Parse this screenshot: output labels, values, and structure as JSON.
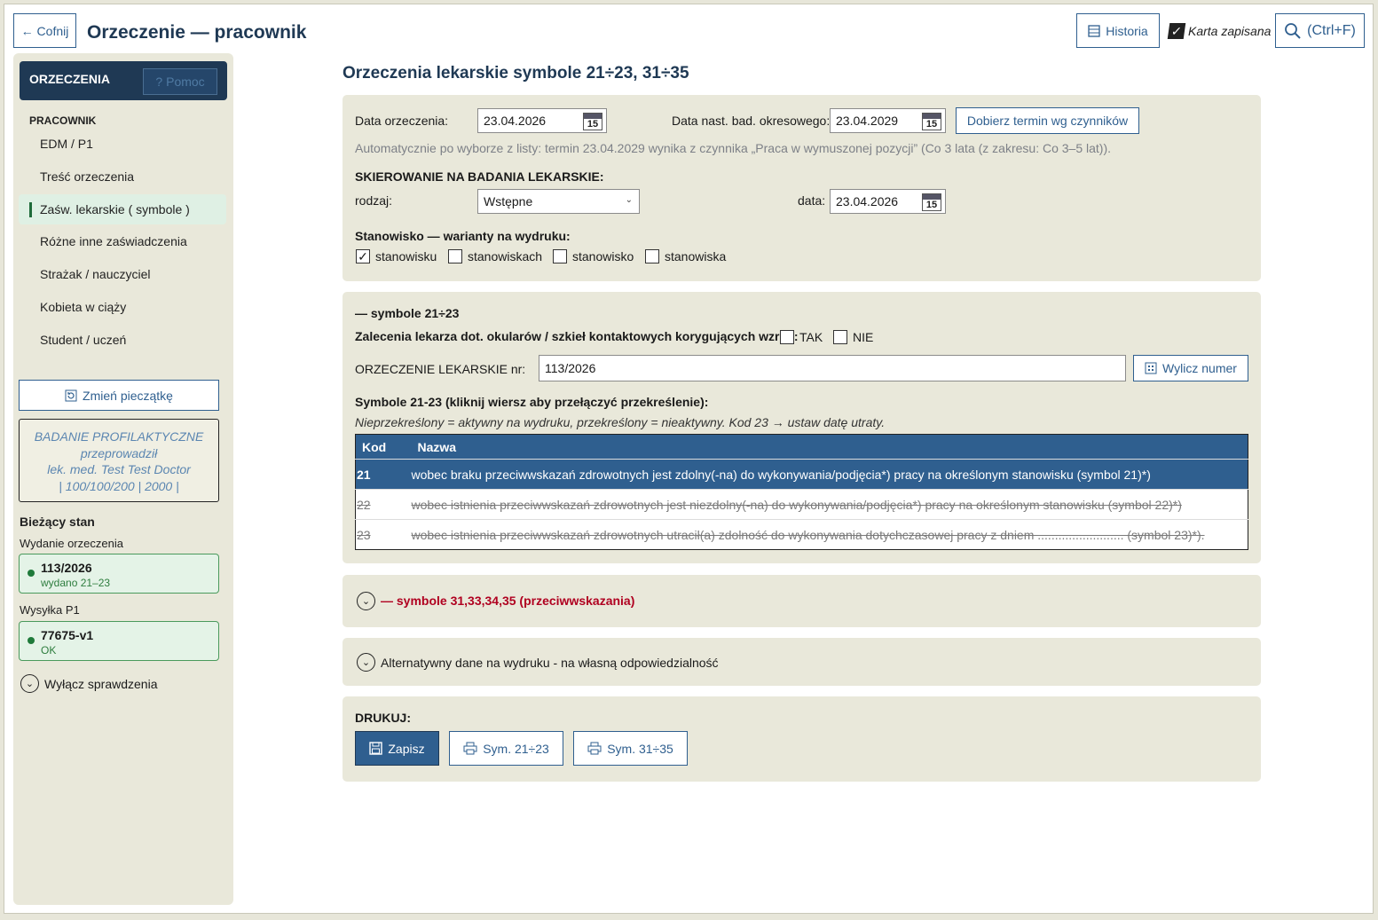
{
  "header": {
    "back_label": "← Cofnij",
    "title": "Orzeczenie — pracownik",
    "history_label": "Historia",
    "saved_label": "Karta zapisana",
    "search_label": "(Ctrl+F)"
  },
  "sidebar": {
    "title": "ORZECZENIA",
    "help_label": "Pomoc",
    "section": "PRACOWNIK",
    "items": [
      {
        "label": "EDM / P1"
      },
      {
        "label": "Treść orzeczenia"
      },
      {
        "label": "Zaśw. lekarskie ( symbole )"
      },
      {
        "label": "Różne inne zaświadczenia"
      },
      {
        "label": "Strażak / nauczyciel"
      },
      {
        "label": "Kobieta w ciąży"
      },
      {
        "label": "Student / uczeń"
      }
    ],
    "stamp_button": "Zmień pieczątkę",
    "stamp": {
      "line1": "BADANIE PROFILAKTYCZNE",
      "line2": "przeprowadził",
      "line3": "lek. med. Test Test Doctor",
      "line4": "| 100/100/200 | 2000 |"
    },
    "state_title": "Bieżący stan",
    "issue_label": "Wydanie orzeczenia",
    "issue_value": "113/2026",
    "issue_sub": "wydano 21–23",
    "send_label": "Wysyłka P1",
    "send_value": "77675-v1",
    "send_sub": "OK",
    "checks_toggle": "Wyłącz sprawdzenia"
  },
  "main": {
    "title": "Orzeczenia lekarskie symbole 21÷23, 31÷35",
    "top": {
      "date_label": "Data orzeczenia:",
      "date_value": "23.04.2026",
      "next_label": "Data nast. bad. okresowego:",
      "next_value": "23.04.2029",
      "pick_button": "Dobierz termin wg czynników",
      "hint": "Automatycznie po wyborze z listy: termin 23.04.2029 wynika z czynnika „Praca w wymuszonej pozycji” (Co 3 lata (z zakresu: Co 3–5 lat)).",
      "referral_title": "SKIEROWANIE NA BADANIA LEKARSKIE:",
      "kind_label": "rodzaj:",
      "kind_value": "Wstępne",
      "date2_label": "data:",
      "date2_value": "23.04.2026",
      "position_title": "Stanowisko — warianty na wydruku:",
      "options": [
        {
          "label": "stanowisku",
          "checked": true
        },
        {
          "label": "stanowiskach",
          "checked": false
        },
        {
          "label": "stanowisko",
          "checked": false
        },
        {
          "label": "stanowiska",
          "checked": false
        }
      ]
    },
    "sym21": {
      "title": "— symbole 21÷23",
      "glasses_label": "Zalecenia lekarza dot. okularów / szkieł kontaktowych korygujących wzrok:",
      "yes": "TAK",
      "no": "NIE",
      "number_label": "ORZECZENIE LEKARSKIE nr:",
      "number_value": "113/2026",
      "calc_button": "Wylicz numer",
      "list_title": "Symbole 21-23 (kliknij wiersz aby przełączyć przekreślenie):",
      "list_hint": "Nieprzekreślony = aktywny na wydruku, przekreślony = nieaktywny. Kod 23 → ustaw datę utraty.",
      "col_code": "Kod",
      "col_name": "Nazwa",
      "rows": [
        {
          "code": "21",
          "name": "wobec braku przeciwwskazań zdrowotnych jest zdolny(-na) do wykonywania/podjęcia*) pracy na określonym stanowisku (symbol 21)*)"
        },
        {
          "code": "22",
          "name": "wobec istnienia przeciwwskazań zdrowotnych jest niezdolny(-na) do wykonywania/podjęcia*) pracy na określonym stanowisku (symbol 22)*)"
        },
        {
          "code": "23",
          "name": "wobec istnienia przeciwwskazań zdrowotnych utracił(a) zdolność do wykonywania dotychczasowej pracy z dniem ......................... (symbol 23)*)."
        }
      ]
    },
    "sym31": {
      "title": "— symbole 31,33,34,35 (przeciwwskazania)"
    },
    "alt": {
      "title": "Alternatywny dane na wydruku - na własną odpowiedzialność"
    },
    "print": {
      "title": "DRUKUJ:",
      "save": "Zapisz",
      "sym21": "Sym. 21÷23",
      "sym31": "Sym. 31÷35"
    }
  }
}
